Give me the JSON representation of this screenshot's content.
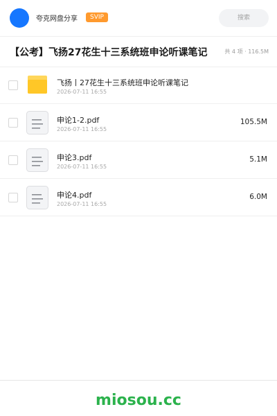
{
  "header": {
    "brand": "夸克网盘分享",
    "badge": "SVIP",
    "search_label": "搜索"
  },
  "share": {
    "title": "【公考】飞扬27花生十三系统班申论听课笔记",
    "meta": "共 4 项 · 116.5M"
  },
  "items": [
    {
      "type": "folder",
      "icon": "folder-icon",
      "name": "飞扬丨27花生十三系统班申论听课笔记",
      "date": "2026-07-11 16:55",
      "size": ""
    },
    {
      "type": "file",
      "icon": "file-icon",
      "name": "申论1-2.pdf",
      "date": "2026-07-11 16:55",
      "size": "105.5M"
    },
    {
      "type": "file",
      "icon": "file-icon",
      "name": "申论3.pdf",
      "date": "2026-07-11 16:55",
      "size": "5.1M"
    },
    {
      "type": "file",
      "icon": "file-icon",
      "name": "申论4.pdf",
      "date": "2026-07-11 16:55",
      "size": "6.0M"
    }
  ],
  "footer": {
    "watermark": "miosou.cc"
  },
  "colors": {
    "accent": "#1677ff",
    "svip": "#ff9a2e",
    "folder": "#ffc727",
    "watermark": "#2bb24c"
  }
}
